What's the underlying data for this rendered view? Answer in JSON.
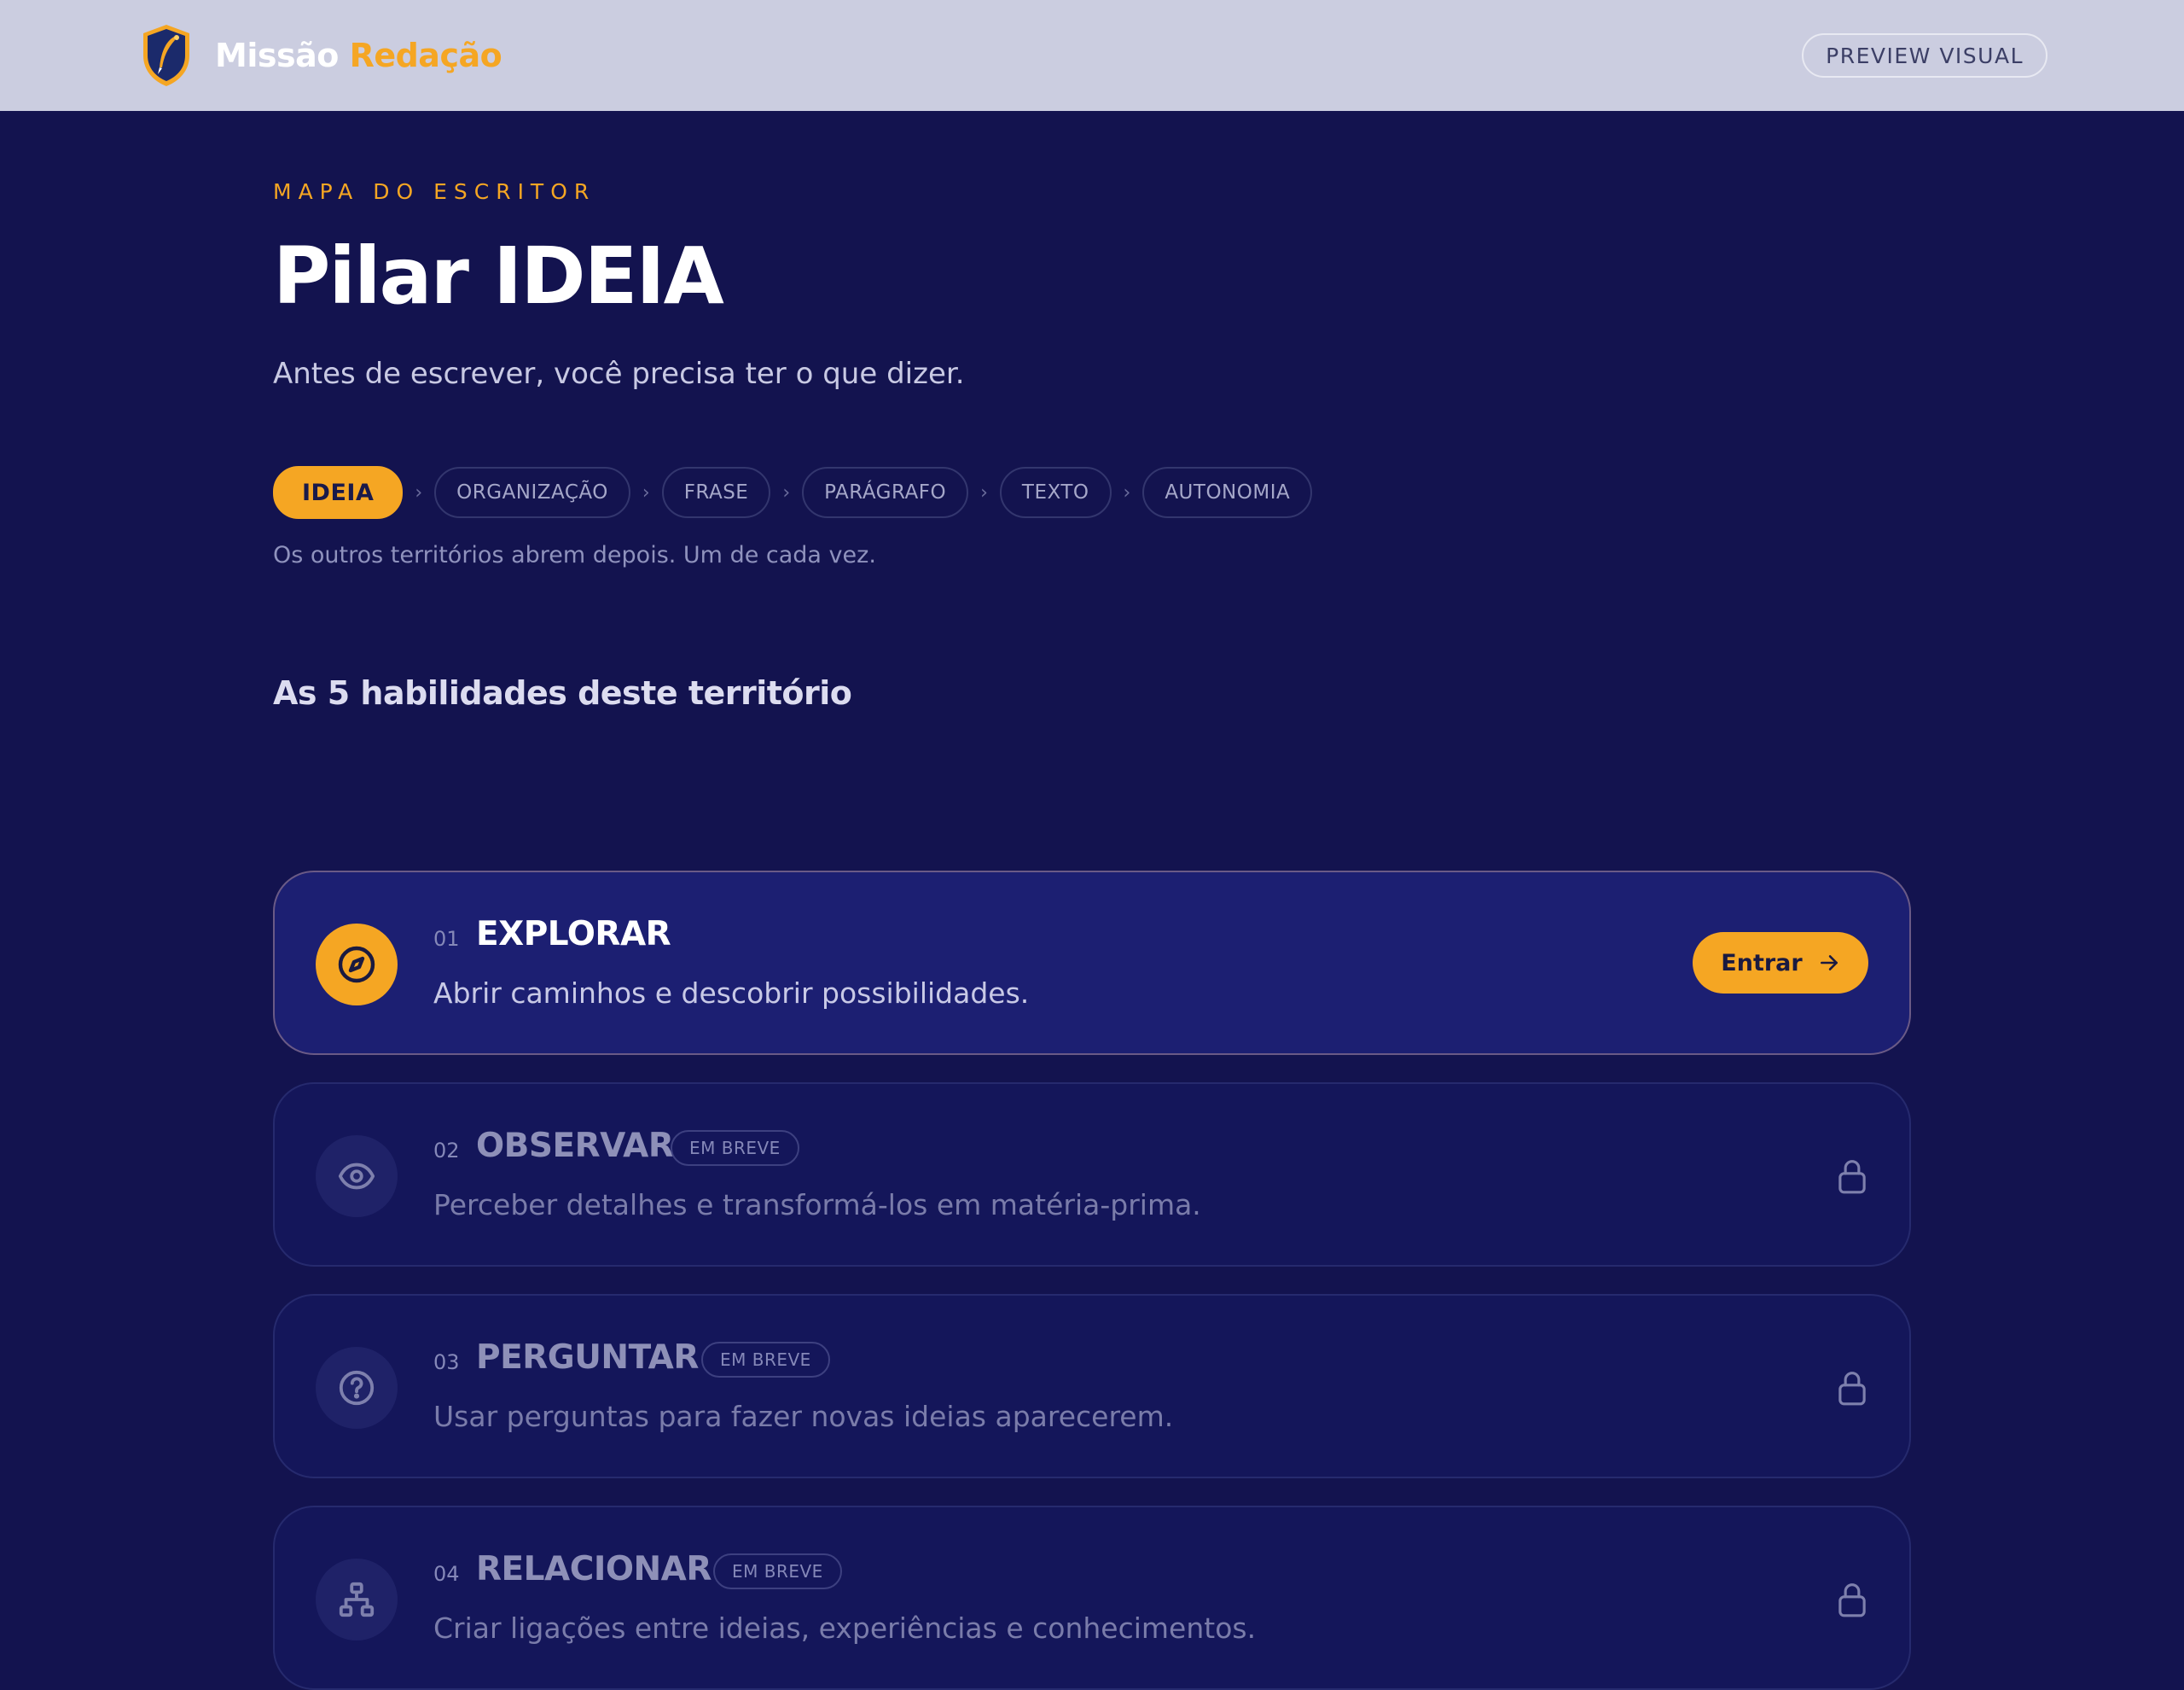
{
  "header": {
    "brand_part1": "Missão",
    "brand_part2": "Redação",
    "preview_label": "PREVIEW VISUAL"
  },
  "hero": {
    "eyebrow": "MAPA DO ESCRITOR",
    "title": "Pilar IDEIA",
    "subtitle": "Antes de escrever, você precisa ter o que dizer."
  },
  "path": {
    "steps": [
      {
        "label": "IDEIA",
        "active": true
      },
      {
        "label": "ORGANIZAÇÃO",
        "active": false
      },
      {
        "label": "FRASE",
        "active": false
      },
      {
        "label": "PARÁGRAFO",
        "active": false
      },
      {
        "label": "TEXTO",
        "active": false
      },
      {
        "label": "AUTONOMIA",
        "active": false
      }
    ],
    "separator": "›",
    "note": "Os outros territórios abrem depois. Um de cada vez."
  },
  "skills": {
    "section_title": "As 5 habilidades deste território",
    "items": [
      {
        "number": "01",
        "name": "EXPLORAR",
        "description": "Abrir caminhos e descobrir possibilidades.",
        "icon": "compass-icon",
        "status": "open",
        "action_label": "Entrar"
      },
      {
        "number": "02",
        "name": "OBSERVAR",
        "description": "Perceber detalhes e transformá-los em matéria-prima.",
        "icon": "eye-icon",
        "status": "locked",
        "badge": "EM BREVE"
      },
      {
        "number": "03",
        "name": "PERGUNTAR",
        "description": "Usar perguntas para fazer novas ideias aparecerem.",
        "icon": "question-icon",
        "status": "locked",
        "badge": "EM BREVE"
      },
      {
        "number": "04",
        "name": "RELACIONAR",
        "description": "Criar ligações entre ideias, experiências e conhecimentos.",
        "icon": "network-icon",
        "status": "locked",
        "badge": "EM BREVE"
      }
    ]
  },
  "colors": {
    "background": "#13134f",
    "header": "#cbcde0",
    "accent": "#f5a623",
    "card": "#14165a",
    "card_active": "#1c1f72"
  }
}
